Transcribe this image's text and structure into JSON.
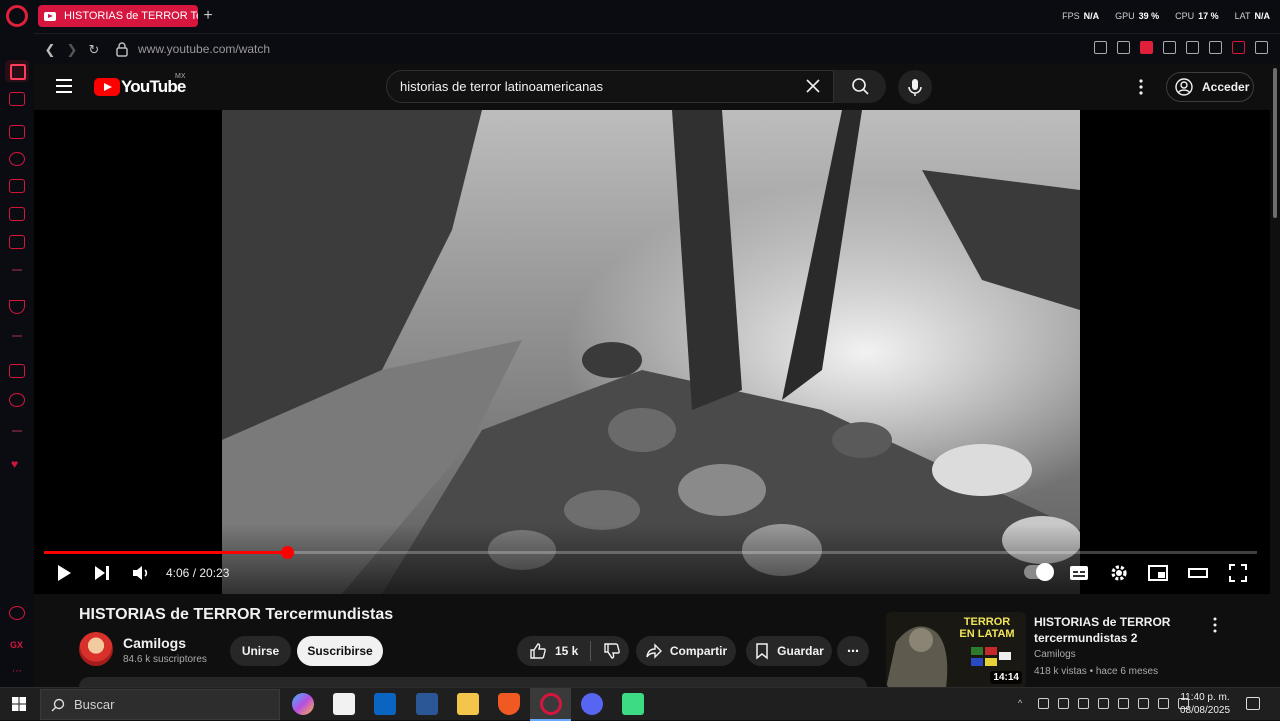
{
  "browser": {
    "tab_title": "HISTORIAS de TERROR Te",
    "url": "www.youtube.com/watch",
    "perf": [
      {
        "label": "FPS",
        "value": "N/A"
      },
      {
        "label": "GPU",
        "value": "39 %"
      },
      {
        "label": "CPU",
        "value": "17 %"
      },
      {
        "label": "LAT",
        "value": "N/A"
      }
    ],
    "accent": "#d6163f"
  },
  "youtube": {
    "logo_text": "YouTube",
    "region": "MX",
    "search_query": "historias de terror latinoamericanas",
    "signin_label": "Acceder"
  },
  "player": {
    "time_current": "4:06",
    "time_total": "20:23",
    "time_display": "4:06 / 20:23",
    "progress_fraction": 0.2
  },
  "video": {
    "title": "HISTORIAS de TERROR Tercermundistas",
    "channel_name": "Camilogs",
    "channel_subs": "84.6 k suscriptores",
    "join_label": "Unirse",
    "subscribe_label": "Suscribirse",
    "like_count": "15 k",
    "share_label": "Compartir",
    "save_label": "Guardar"
  },
  "recommendation": {
    "title": "HISTORIAS de TERROR tercermundistas 2",
    "channel": "Camilogs",
    "meta": "418 k vistas • hace 6 meses",
    "duration": "14:14",
    "thumb_text": "TERROR EN LATAM"
  },
  "taskbar": {
    "search_label": "Buscar",
    "time": "11:40 p. m.",
    "date": "08/08/2025"
  }
}
